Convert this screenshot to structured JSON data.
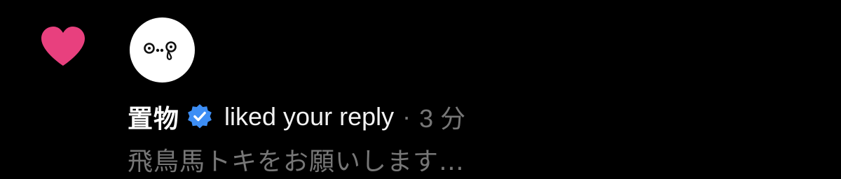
{
  "notification": {
    "type_icon": "heart-icon",
    "avatar_icon": "face-emoticon-icon",
    "username": "置物",
    "verified_icon": "verified-badge-icon",
    "action": "liked your reply",
    "separator": "·",
    "time": "3 分",
    "preview": "飛鳥馬トキをお願いします…"
  },
  "colors": {
    "background": "#000000",
    "heart": "#e8407e",
    "verified": "#3d8ef5",
    "primary_text": "#ffffff",
    "secondary_text": "#777777"
  }
}
